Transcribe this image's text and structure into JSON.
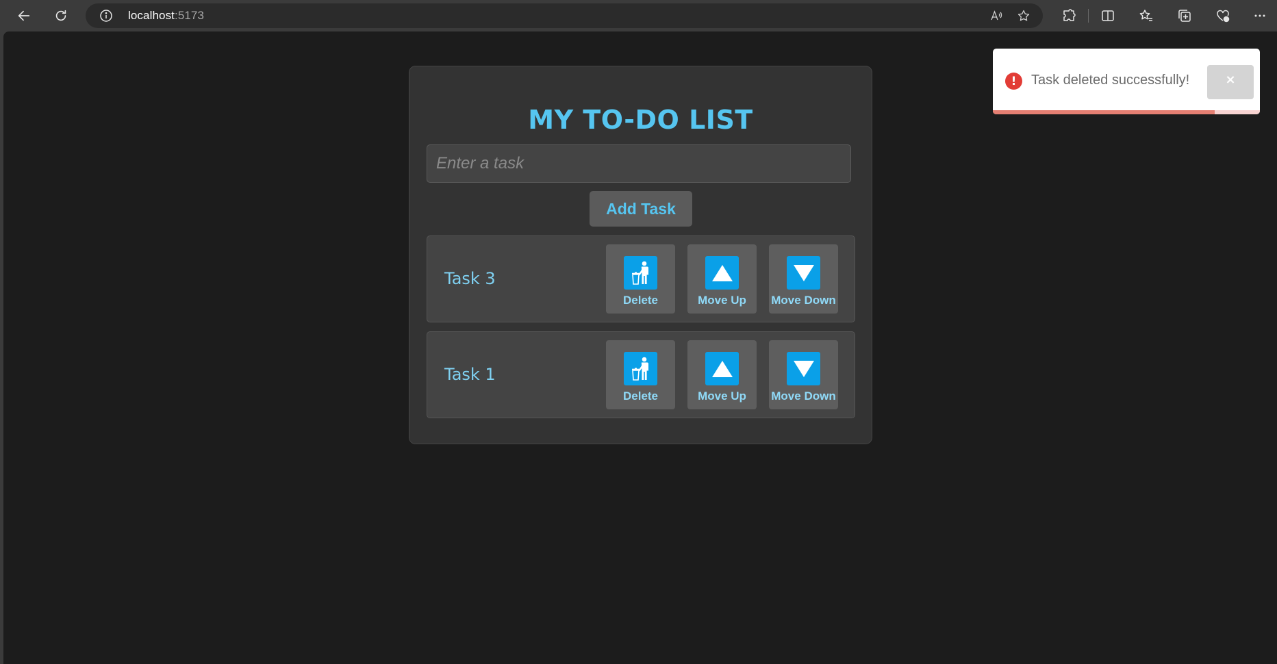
{
  "browser": {
    "url_host": "localhost",
    "url_port": ":5173"
  },
  "app": {
    "title": "MY TO-DO LIST",
    "input_placeholder": "Enter a task",
    "input_value": "",
    "add_button_label": "Add Task",
    "accent_color": "#56c5f0"
  },
  "tasks": [
    {
      "text": "Task 3",
      "actions": {
        "delete": "Delete",
        "up": "Move Up",
        "down": "Move Down"
      }
    },
    {
      "text": "Task 1",
      "actions": {
        "delete": "Delete",
        "up": "Move Up",
        "down": "Move Down"
      }
    }
  ],
  "toast": {
    "message": "Task deleted successfully!",
    "type": "error",
    "close_symbol": "×",
    "icon_symbol": "!",
    "progress_fraction": 0.83
  }
}
